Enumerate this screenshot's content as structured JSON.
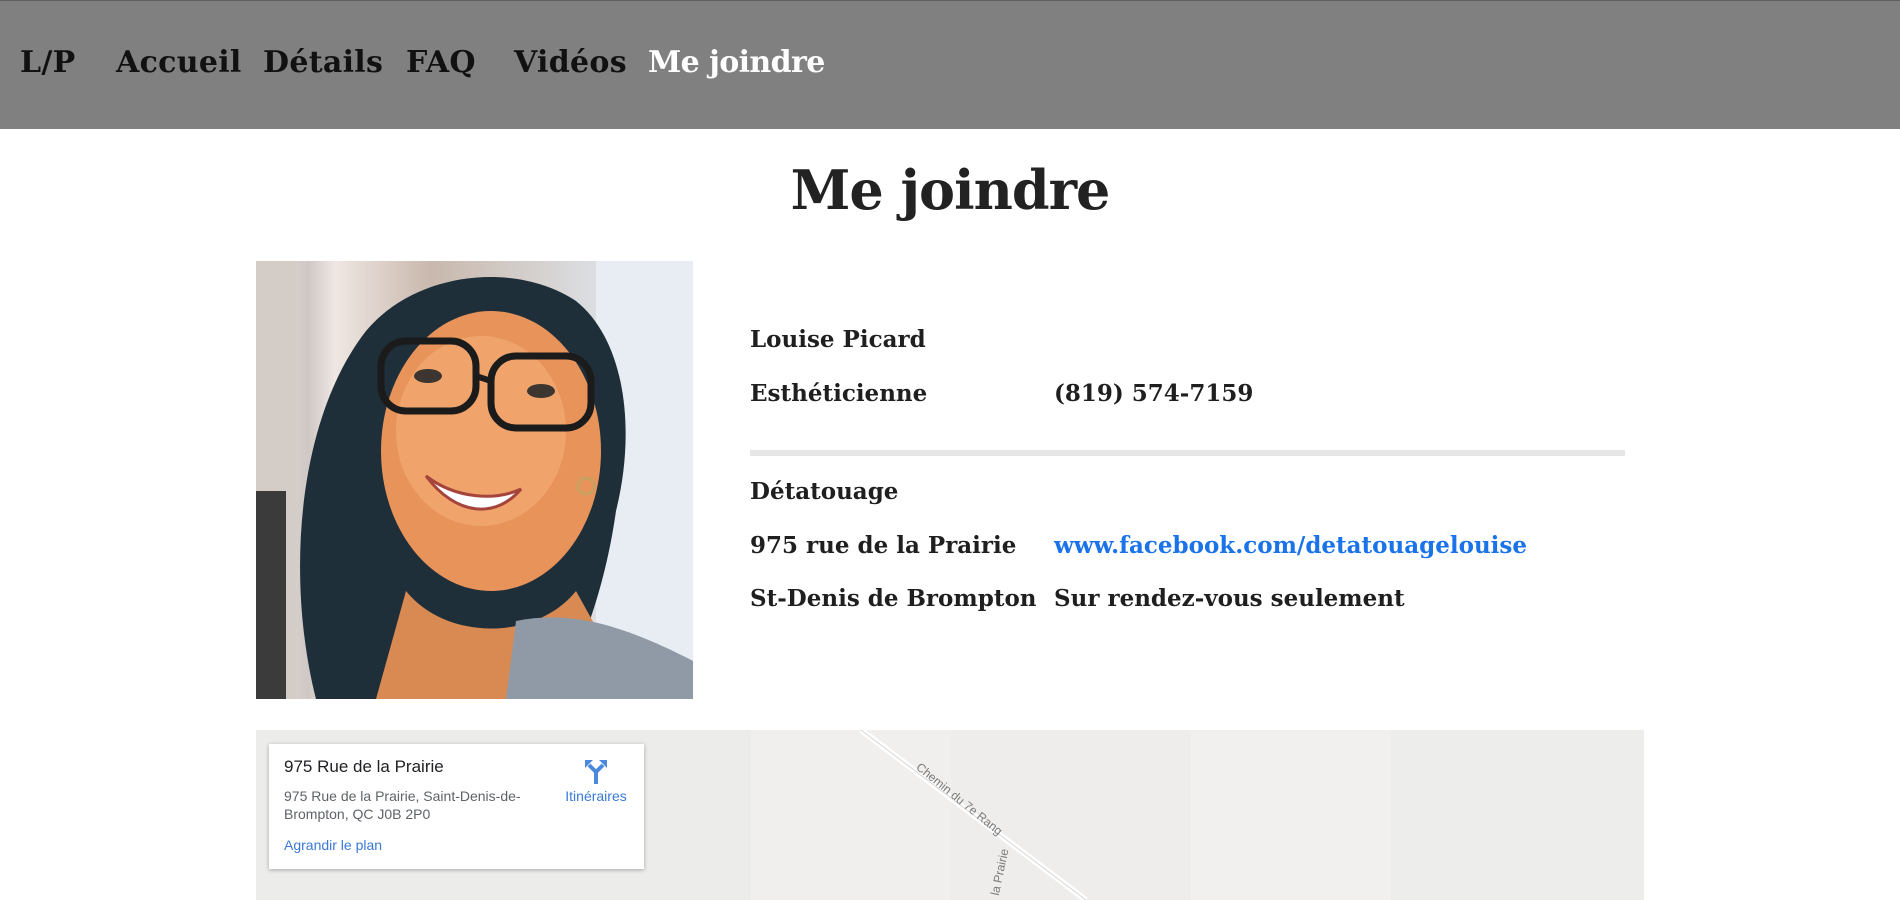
{
  "nav": {
    "brand": "L/P",
    "items": [
      {
        "label": "Accueil"
      },
      {
        "label": "Détails"
      },
      {
        "label": "FAQ"
      },
      {
        "label": "Vidéos"
      },
      {
        "label": "Me joindre",
        "active": true
      }
    ]
  },
  "page": {
    "title": "Me joindre"
  },
  "contact": {
    "name": "Louise Picard",
    "role": "Esthéticienne",
    "phone": "(819) 574-7159",
    "service": "Détatouage",
    "street": "975 rue de la Prairie",
    "city": "St-Denis de Brompton",
    "facebook": "www.facebook.com/detatouagelouise",
    "appointment": "Sur rendez-vous seulement"
  },
  "map": {
    "card_title": "975 Rue de la Prairie",
    "card_address": "975 Rue de la Prairie, Saint-Denis-de-Brompton, QC J0B 2P0",
    "directions_label": "Itinéraires",
    "enlarge_label": "Agrandir le plan",
    "road_labels": [
      "Chemin du 7e Rang",
      "la Prairie"
    ]
  },
  "colors": {
    "nav_background": "#808080",
    "nav_active": "#ffffff",
    "link": "#1a73e8",
    "map_link": "#3a79d8"
  },
  "icons": [
    "directions-icon"
  ]
}
